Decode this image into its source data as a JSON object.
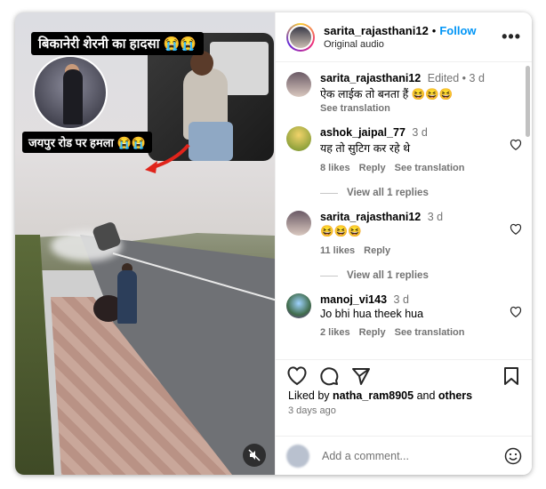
{
  "media": {
    "overlay_title": "बिकानेरी शेरनी का हादसा 😭😭",
    "overlay_sub": "जयपुर रोड पर हमला 😭😭",
    "mute_icon": "speaker-muted-icon"
  },
  "header": {
    "username": "sarita_rajasthani12",
    "separator": "•",
    "follow_label": "Follow",
    "audio_label": "Original audio",
    "more_icon": "•••"
  },
  "comments": [
    {
      "username": "sarita_rajasthani12",
      "meta": "Edited • 3 d",
      "text": "ऐक लाईक तो बनता हैं 😆😆😆",
      "actions": [
        "See translation"
      ],
      "avatar_color": "#6b5a66",
      "has_heart": false
    },
    {
      "username": "ashok_jaipal_77",
      "meta": "3 d",
      "text": "यह तो सुटिग कर रहे थे",
      "actions": [
        "8 likes",
        "Reply",
        "See translation"
      ],
      "avatar_color": "#c9b02a",
      "has_heart": true,
      "replies": "View all 1 replies"
    },
    {
      "username": "sarita_rajasthani12",
      "meta": "3 d",
      "text": "😆😆😆",
      "actions": [
        "11 likes",
        "Reply"
      ],
      "avatar_color": "#6b5a66",
      "has_heart": true,
      "replies": "View all 1 replies"
    },
    {
      "username": "manoj_vi143",
      "meta": "3 d",
      "text": "Jo bhi hua theek hua",
      "actions": [
        "2 likes",
        "Reply",
        "See translation"
      ],
      "avatar_color": "#3f6b4a",
      "has_heart": true
    }
  ],
  "footer": {
    "liked_prefix": "Liked by",
    "liked_user": "natha_ram8905",
    "liked_and": "and",
    "liked_others": "others",
    "date": "3 days ago",
    "add_comment_placeholder": "Add a comment..."
  }
}
